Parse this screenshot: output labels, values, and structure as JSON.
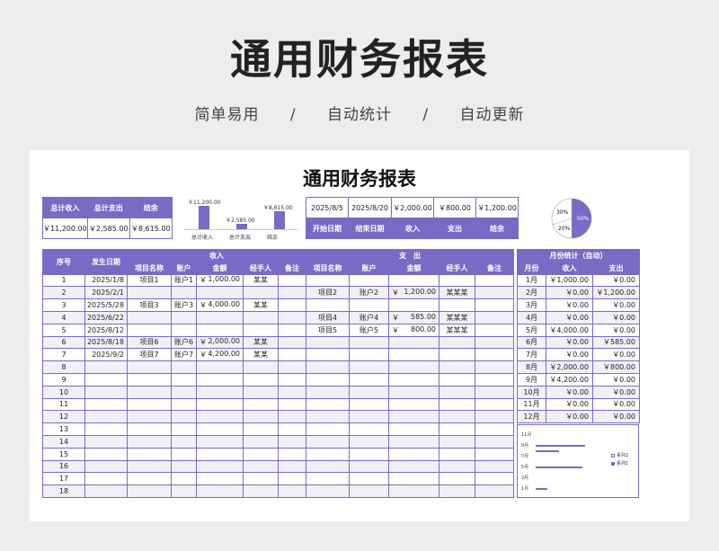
{
  "hero": {
    "title": "通用财务报表",
    "subtitle": [
      "简单易用",
      "/",
      "自动统计",
      "/",
      "自动更新"
    ]
  },
  "sheet_title": "通用财务报表",
  "summary": {
    "headers": [
      "总计收入",
      "总计支出",
      "结余"
    ],
    "values": [
      "￥11,200.00",
      "￥2,585.00",
      "￥8,615.00"
    ]
  },
  "mini_chart": {
    "values": [
      11200,
      2585,
      8615
    ],
    "value_labels": [
      "￥11,200.00",
      "￥2,585.00",
      "￥8,615.00"
    ],
    "labels": [
      "总计收入",
      "总计支出",
      "结余"
    ]
  },
  "dates": {
    "values": [
      "2025/8/5",
      "2025/8/20",
      "￥2,000.00",
      "￥800.00",
      "￥1,200.00"
    ],
    "labels": [
      "开始日期",
      "结束日期",
      "收入",
      "支出",
      "结余"
    ]
  },
  "pie": {
    "slices": [
      {
        "label": "50%",
        "value": 50,
        "color": "#7a6ac5"
      },
      {
        "label": "20%",
        "value": 20,
        "color": "#ffffff"
      },
      {
        "label": "30%",
        "value": 30,
        "color": "#ffffff"
      }
    ]
  },
  "main_table": {
    "col_seq": "序号",
    "col_date": "发生日期",
    "income_group": "收入",
    "expense_group": "支　出",
    "sub_headers": [
      "项目名称",
      "账户",
      "金额",
      "经手人",
      "备注"
    ],
    "rows": [
      {
        "seq": "1",
        "date": "2025/1/8",
        "in_item": "项目1",
        "in_acc": "账户1",
        "in_amt": "1,000.00",
        "in_person": "某某",
        "ex_item": "",
        "ex_acc": "",
        "ex_amt": "",
        "ex_person": ""
      },
      {
        "seq": "2",
        "date": "2025/2/1",
        "in_item": "",
        "in_acc": "",
        "in_amt": "",
        "in_person": "",
        "ex_item": "项目2",
        "ex_acc": "账户2",
        "ex_amt": "1,200.00",
        "ex_person": "某某某"
      },
      {
        "seq": "3",
        "date": "2025/5/28",
        "in_item": "项目3",
        "in_acc": "账户3",
        "in_amt": "4,000.00",
        "in_person": "某某",
        "ex_item": "",
        "ex_acc": "",
        "ex_amt": "",
        "ex_person": ""
      },
      {
        "seq": "4",
        "date": "2025/6/22",
        "in_item": "",
        "in_acc": "",
        "in_amt": "",
        "in_person": "",
        "ex_item": "项目4",
        "ex_acc": "账户4",
        "ex_amt": "585.00",
        "ex_person": "某某某"
      },
      {
        "seq": "5",
        "date": "2025/8/12",
        "in_item": "",
        "in_acc": "",
        "in_amt": "",
        "in_person": "",
        "ex_item": "项目5",
        "ex_acc": "账户5",
        "ex_amt": "800.00",
        "ex_person": "某某某"
      },
      {
        "seq": "6",
        "date": "2025/8/18",
        "in_item": "项目6",
        "in_acc": "账户6",
        "in_amt": "2,000.00",
        "in_person": "某某",
        "ex_item": "",
        "ex_acc": "",
        "ex_amt": "",
        "ex_person": ""
      },
      {
        "seq": "7",
        "date": "2025/9/2",
        "in_item": "项目7",
        "in_acc": "账户7",
        "in_amt": "4,200.00",
        "in_person": "某某",
        "ex_item": "",
        "ex_acc": "",
        "ex_amt": "",
        "ex_person": ""
      },
      {
        "seq": "8"
      },
      {
        "seq": "9"
      },
      {
        "seq": "10"
      },
      {
        "seq": "11"
      },
      {
        "seq": "12"
      },
      {
        "seq": "13"
      },
      {
        "seq": "14"
      },
      {
        "seq": "15"
      },
      {
        "seq": "16"
      },
      {
        "seq": "17"
      },
      {
        "seq": "18"
      }
    ]
  },
  "monthly": {
    "title": "月份统计（自动）",
    "headers": [
      "月份",
      "收入",
      "支出"
    ],
    "rows": [
      {
        "month": "1月",
        "income": "￥1,000.00",
        "expense": "￥0.00"
      },
      {
        "month": "2月",
        "income": "￥0.00",
        "expense": "￥1,200.00"
      },
      {
        "month": "3月",
        "income": "￥0.00",
        "expense": "￥0.00"
      },
      {
        "month": "4月",
        "income": "￥0.00",
        "expense": "￥0.00"
      },
      {
        "month": "5月",
        "income": "￥4,000.00",
        "expense": "￥0.00"
      },
      {
        "month": "6月",
        "income": "￥0.00",
        "expense": "￥585.00"
      },
      {
        "month": "7月",
        "income": "￥0.00",
        "expense": "￥0.00"
      },
      {
        "month": "8月",
        "income": "￥2,000.00",
        "expense": "￥800.00"
      },
      {
        "month": "9月",
        "income": "￥4,200.00",
        "expense": "￥0.00"
      },
      {
        "month": "10月",
        "income": "￥0.00",
        "expense": "￥0.00"
      },
      {
        "month": "11月",
        "income": "￥0.00",
        "expense": "￥0.00"
      },
      {
        "month": "12月",
        "income": "￥0.00",
        "expense": "￥0.00"
      }
    ]
  },
  "bar_chart": {
    "y_labels": [
      "11月",
      "9月",
      "7月",
      "5月",
      "3月",
      "1月"
    ],
    "bars": [
      {
        "label": "9月",
        "value": 4200
      },
      {
        "label": "8月",
        "value": 2000
      },
      {
        "label": "5月",
        "value": 4000
      },
      {
        "label": "1月",
        "value": 1000
      }
    ],
    "legend": [
      "系列2",
      "系列1"
    ]
  },
  "colors": {
    "accent": "#7a6ac5",
    "row_alt": "#f1f0f8"
  }
}
